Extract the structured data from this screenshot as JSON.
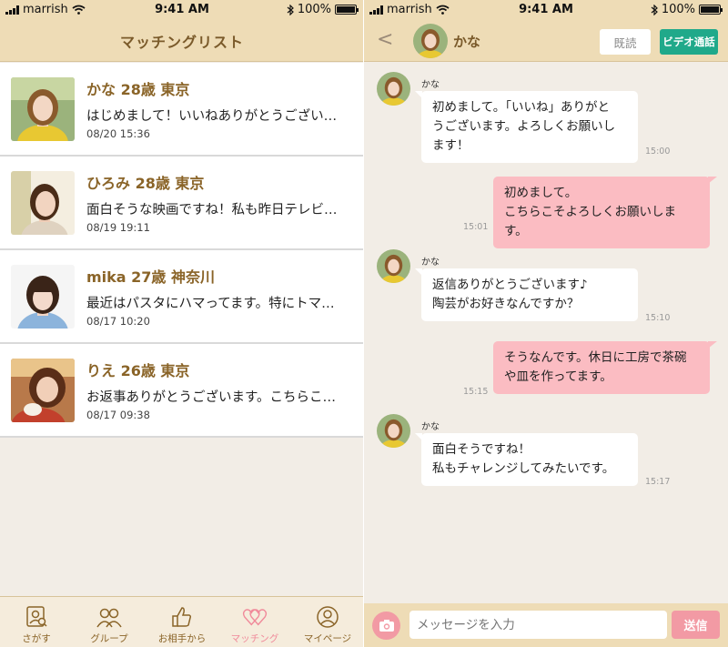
{
  "status_left": {
    "carrier": "marrish",
    "time": "9:41 AM",
    "battery": "100%"
  },
  "status_right": {
    "carrier": "marrish",
    "time": "9:41 AM",
    "battery": "100%"
  },
  "matching": {
    "title": "マッチングリスト",
    "items": [
      {
        "name": "かな 28歳 東京",
        "preview": "はじめまして！いいねありがとうござい…",
        "date": "08/20 15:36"
      },
      {
        "name": "ひろみ 28歳 東京",
        "preview": "面白そうな映画ですね！私も昨日テレビ…",
        "date": "08/19 19:11"
      },
      {
        "name": "mika 27歳 神奈川",
        "preview": "最近はパスタにハマってます。特にトマ…",
        "date": "08/17 10:20"
      },
      {
        "name": "りえ 26歳 東京",
        "preview": "お返事ありがとうございます。こちらこ…",
        "date": "08/17 09:38"
      }
    ]
  },
  "tabbar": {
    "tabs": [
      {
        "label": "さがす",
        "icon": "search-profile-icon"
      },
      {
        "label": "グループ",
        "icon": "group-icon"
      },
      {
        "label": "お相手から",
        "icon": "thumbs-up-icon"
      },
      {
        "label": "マッチング",
        "icon": "hearts-icon",
        "active": true
      },
      {
        "label": "マイページ",
        "icon": "user-icon"
      }
    ]
  },
  "chat": {
    "back": "<",
    "partner_name": "かな",
    "read_button": "既読",
    "video_button": "ビデオ通話",
    "messages": [
      {
        "from": "in",
        "sender": "かな",
        "lines": [
          "初めまして。「いいね」ありがと",
          "うございます。よろしくお願いし",
          "ます！"
        ],
        "time": "15:00"
      },
      {
        "from": "out",
        "lines": [
          "初めまして。",
          "こちらこそよろしくお願いします。"
        ],
        "time": "15:01"
      },
      {
        "from": "in",
        "sender": "かな",
        "lines": [
          "返信ありがとうございます♪",
          "陶芸がお好きなんですか？"
        ],
        "time": "15:10"
      },
      {
        "from": "out",
        "lines": [
          "そうなんです。休日に工房で茶碗",
          "や皿を作ってます。"
        ],
        "time": "15:15"
      },
      {
        "from": "in",
        "sender": "かな",
        "lines": [
          "面白そうですね！",
          "私もチャレンジしてみたいです。"
        ],
        "time": "15:17"
      }
    ],
    "input_placeholder": "メッセージを入力",
    "send_label": "送信"
  },
  "colors": {
    "header": "#eedcb6",
    "accent_brown": "#8a6428",
    "pink": "#f29aa4",
    "outgoing_bubble": "#fbbcc2",
    "video_green": "#20a98a"
  }
}
